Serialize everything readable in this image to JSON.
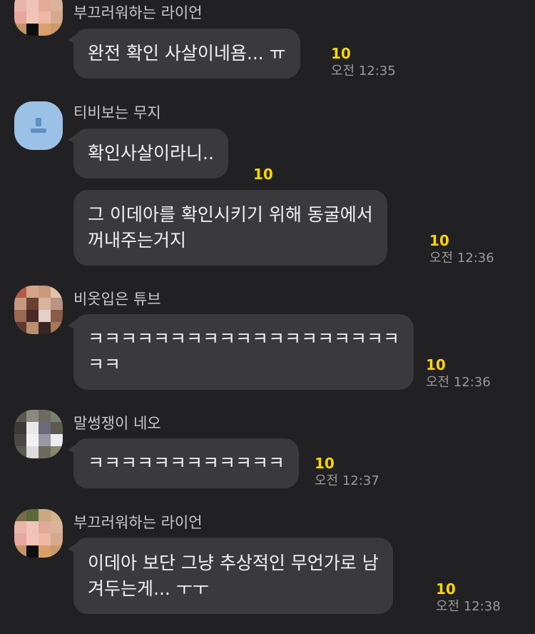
{
  "messages": [
    {
      "sender": "부끄러워하는 라이언",
      "text": "완전 확인 사살이네욤... ㅠ",
      "unread": "10",
      "time": "오전 12:35"
    },
    {
      "sender": "티비보는 무지",
      "text": "확인사살이라니..",
      "unread": "10",
      "time": ""
    },
    {
      "sender": "",
      "text": "그 이데아를 확인시키기 위해 동굴에서\n꺼내주는거지",
      "unread": "10",
      "time": "오전 12:36"
    },
    {
      "sender": "비옷입은 튜브",
      "text": "ㅋㅋㅋㅋㅋㅋㅋㅋㅋㅋㅋㅋㅋㅋㅋㅋㅋㅋㅋ\nㅋㅋ",
      "unread": "10",
      "time": "오전 12:36"
    },
    {
      "sender": "말썽쟁이 네오",
      "text": "ㅋㅋㅋㅋㅋㅋㅋㅋㅋㅋㅋㅋ",
      "unread": "10",
      "time": "오전 12:37"
    },
    {
      "sender": "부끄러워하는 라이언",
      "text": "이데아 보단 그냥 추상적인 무언가로 남\n겨두는게... ㅜㅜ",
      "unread": "10",
      "time": "오전 12:38"
    }
  ],
  "colors": {
    "background": "#212123",
    "bubble": "#3a3a3d",
    "unread": "#ffd500",
    "time": "#9a9a9e",
    "sender": "#c9c9cc"
  }
}
